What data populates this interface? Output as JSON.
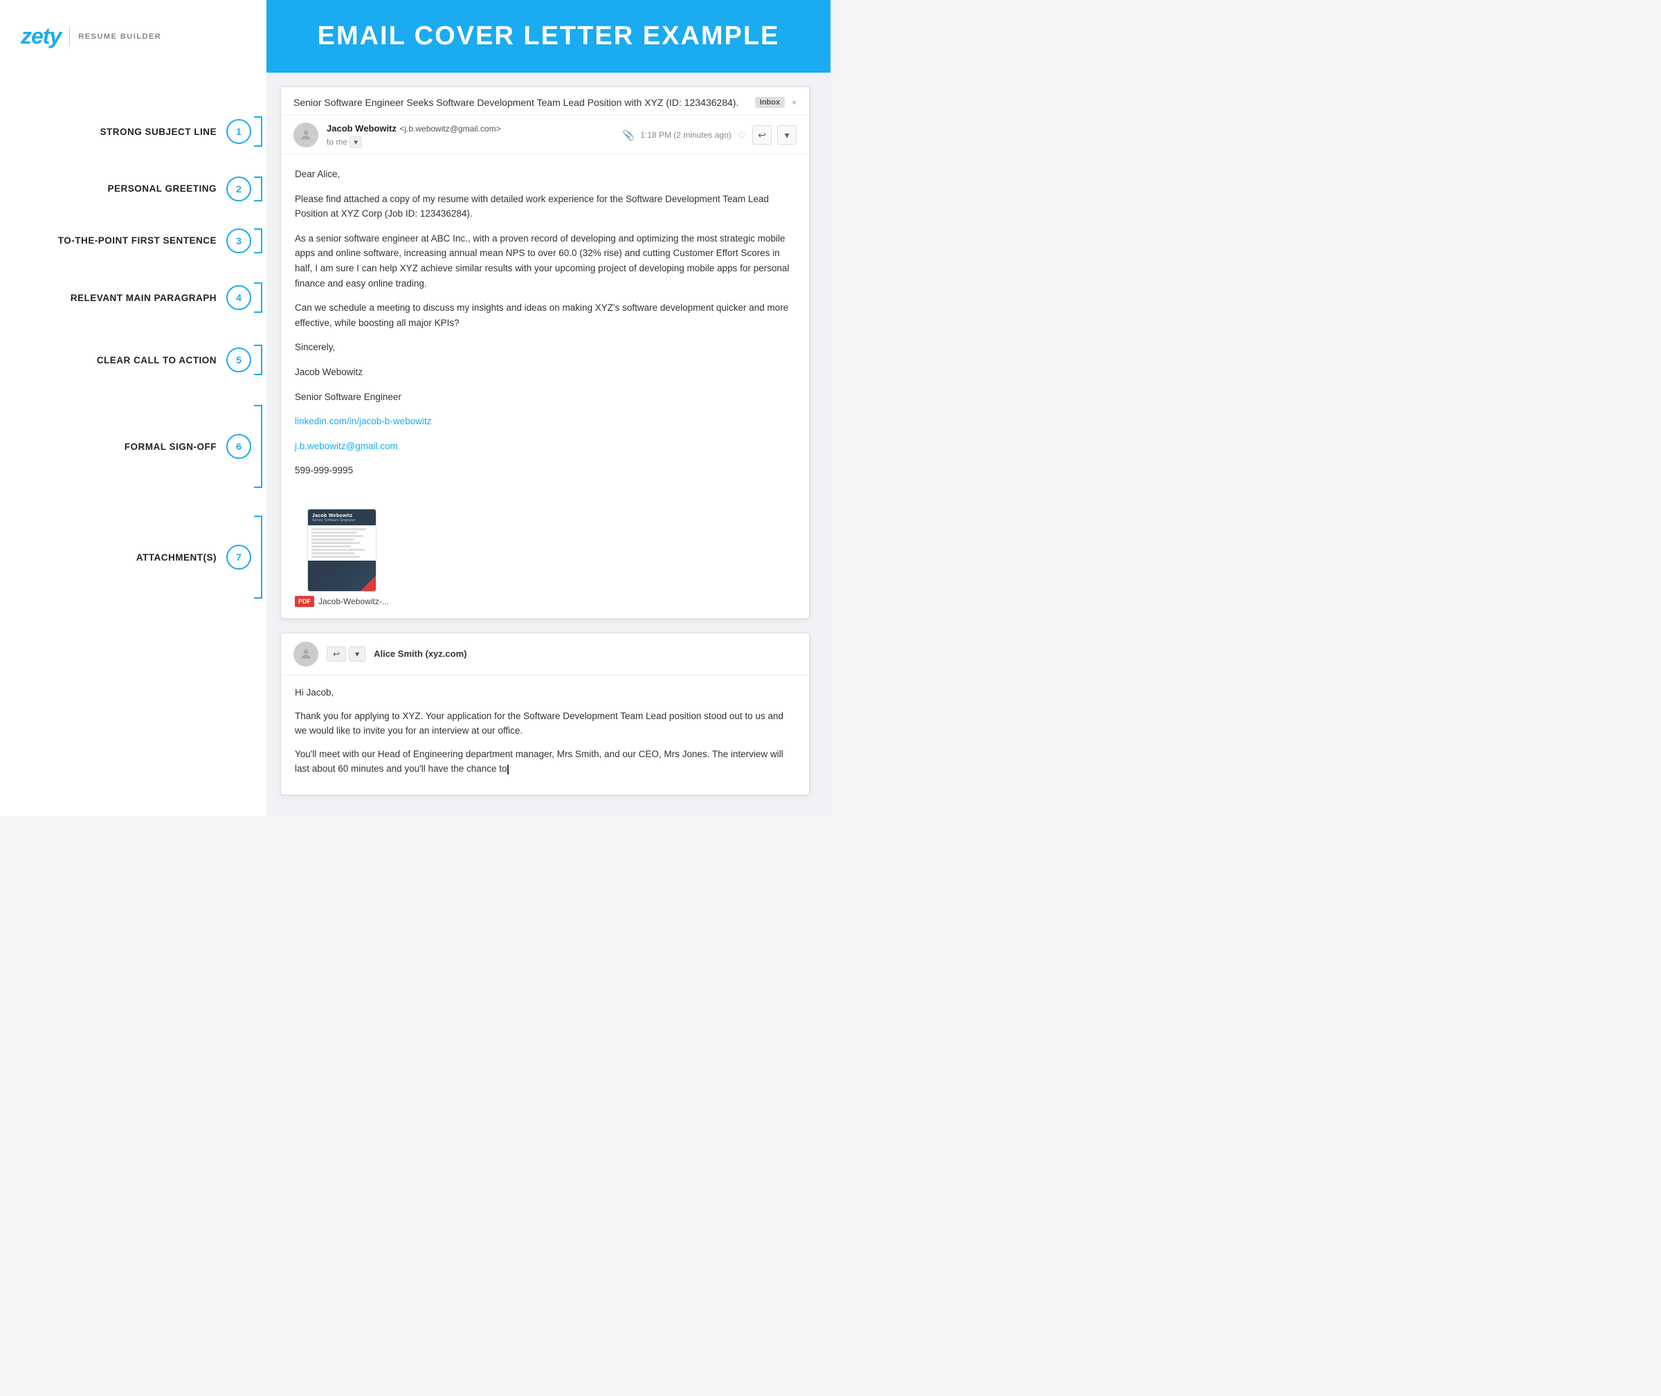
{
  "header": {
    "title": "EMAIL COVER LETTER EXAMPLE",
    "logo": {
      "brand": "zety",
      "divider": "|",
      "subtitle": "RESUME BUILDER"
    }
  },
  "sidebar": {
    "items": [
      {
        "id": 1,
        "label": "STRONG SUBJECT LINE",
        "number": "1"
      },
      {
        "id": 2,
        "label": "PERSONAL GREETING",
        "number": "2"
      },
      {
        "id": 3,
        "label": "TO-THE-POINT FIRST SENTENCE",
        "number": "3"
      },
      {
        "id": 4,
        "label": "RELEVANT MAIN PARAGRAPH",
        "number": "4"
      },
      {
        "id": 5,
        "label": "CLEAR CALL TO ACTION",
        "number": "5"
      },
      {
        "id": 6,
        "label": "FORMAL SIGN-OFF",
        "number": "6"
      },
      {
        "id": 7,
        "label": "ATTACHMENT(S)",
        "number": "7"
      }
    ]
  },
  "email": {
    "subject": "Senior Software Engineer Seeks Software Development Team Lead Position with XYZ (ID: 123436284).",
    "inbox_label": "Inbox",
    "inbox_x": "×",
    "sender_name": "Jacob Webowitz",
    "sender_email": "<j.b.webowitz@gmail.com>",
    "to_label": "to me",
    "timestamp": "1:18 PM (2 minutes ago)",
    "greeting": "Dear Alice,",
    "para1": "Please find attached a copy of my resume with detailed work experience for the Software Development Team Lead Position at XYZ Corp (Job ID: 123436284).",
    "para2": "As a senior software engineer at ABC Inc., with a proven record of developing and optimizing the most strategic mobile apps and online software, increasing annual mean NPS to over 60.0 (32% rise) and cutting Customer Effort Scores in half, I am sure I can help XYZ achieve similar results with your upcoming project of developing mobile apps for personal finance and easy online trading.",
    "para3": "Can we schedule a meeting to discuss my insights and ideas on making XYZ's software development quicker and more effective, while boosting all major KPIs?",
    "closing": "Sincerely,",
    "sender_name_closing": "Jacob Webowitz",
    "sender_title": "Senior Software Engineer",
    "linkedin": "linkedin.com/in/jacob-b-webowitz",
    "email_link": "j.b.webowitz@gmail.com",
    "phone": "599-999-9995",
    "attachment_label": "Jacob-Webowitz-...",
    "pdf_label": "PDF"
  },
  "reply": {
    "reply_from": "Alice Smith (xyz.com)",
    "greeting": "Hi Jacob,",
    "para1": "Thank you for applying to XYZ. Your application for the Software Development Team Lead position stood out to us and we would like to invite you for an interview at our office.",
    "para2": "You'll meet with our Head of Engineering department manager, Mrs Smith, and our CEO, Mrs Jones. The interview will last about 60 minutes and you'll have the chance to"
  },
  "colors": {
    "accent": "#1aabf0",
    "text_dark": "#222222",
    "text_medium": "#555555",
    "text_light": "#888888",
    "border": "#dddddd",
    "bg_light": "#f0f2f5"
  }
}
